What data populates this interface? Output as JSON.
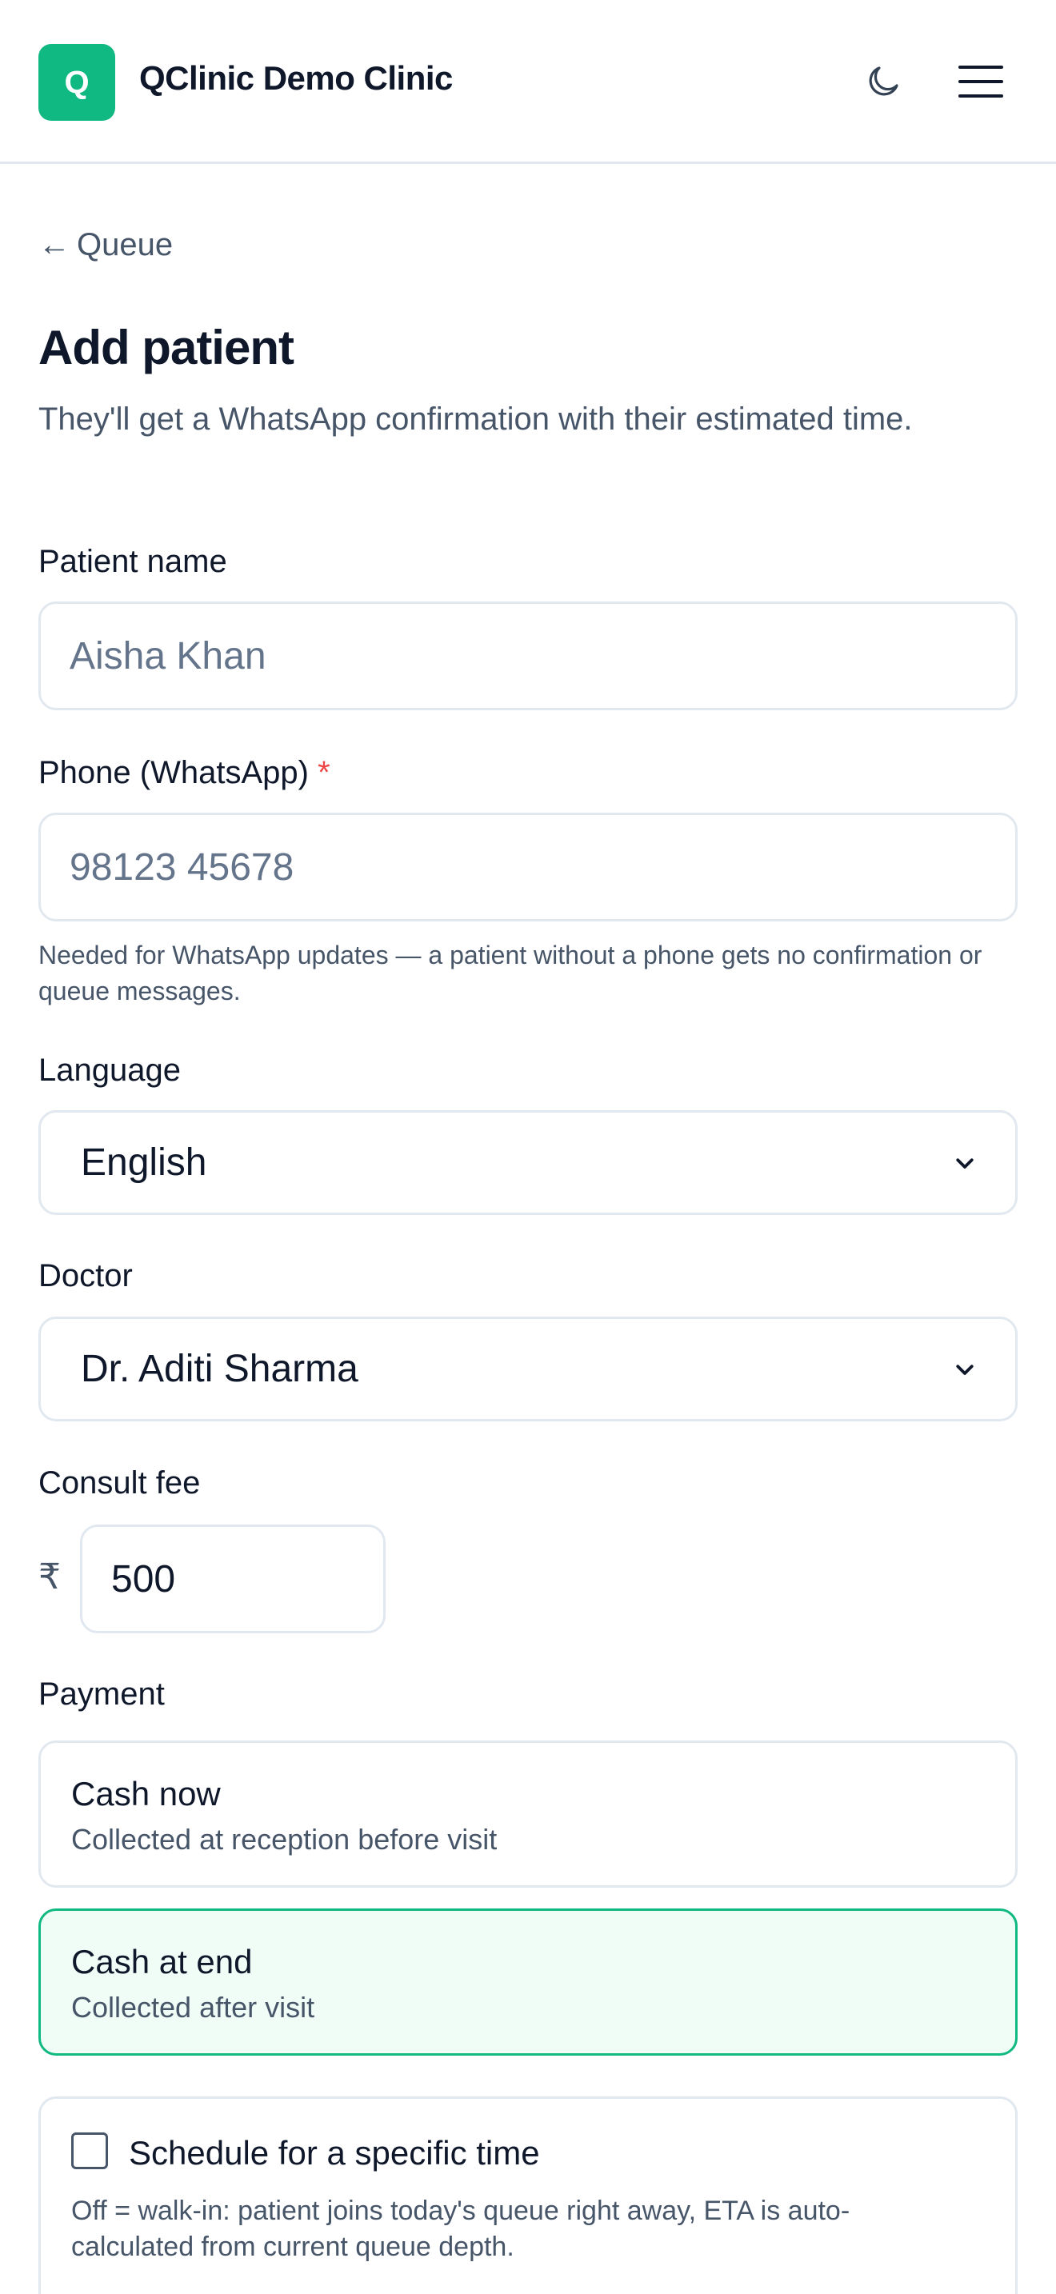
{
  "header": {
    "logo_letter": "Q",
    "clinic_name": "QClinic Demo Clinic"
  },
  "nav": {
    "back_label": "Queue",
    "back_arrow": "←"
  },
  "page": {
    "title": "Add patient",
    "subtitle": "They'll get a WhatsApp confirmation with their estimated time."
  },
  "form": {
    "patient_name": {
      "label": "Patient name",
      "placeholder": "Aisha Khan",
      "value": ""
    },
    "phone": {
      "label": "Phone (WhatsApp)",
      "required_mark": "*",
      "placeholder": "98123 45678",
      "value": "",
      "help": "Needed for WhatsApp updates — a patient without a phone gets no confirmation or queue messages."
    },
    "language": {
      "label": "Language",
      "value": "English"
    },
    "doctor": {
      "label": "Doctor",
      "value": "Dr. Aditi Sharma"
    },
    "consult_fee": {
      "label": "Consult fee",
      "currency": "₹",
      "value": "500"
    },
    "payment": {
      "label": "Payment",
      "options": [
        {
          "title": "Cash now",
          "desc": "Collected at reception before visit",
          "selected": false
        },
        {
          "title": "Cash at end",
          "desc": "Collected after visit",
          "selected": true
        }
      ]
    },
    "schedule": {
      "label": "Schedule for a specific time",
      "checked": false,
      "help": "Off = walk-in: patient joins today's queue right away, ETA is auto-calculated from current queue depth."
    }
  },
  "colors": {
    "brand": "#10b981",
    "selected_bg": "#f0fdf7",
    "required": "#ef4444"
  },
  "icons": {
    "theme": "moon-icon",
    "menu": "hamburger-menu-icon",
    "select": "chevron-down-icon"
  }
}
